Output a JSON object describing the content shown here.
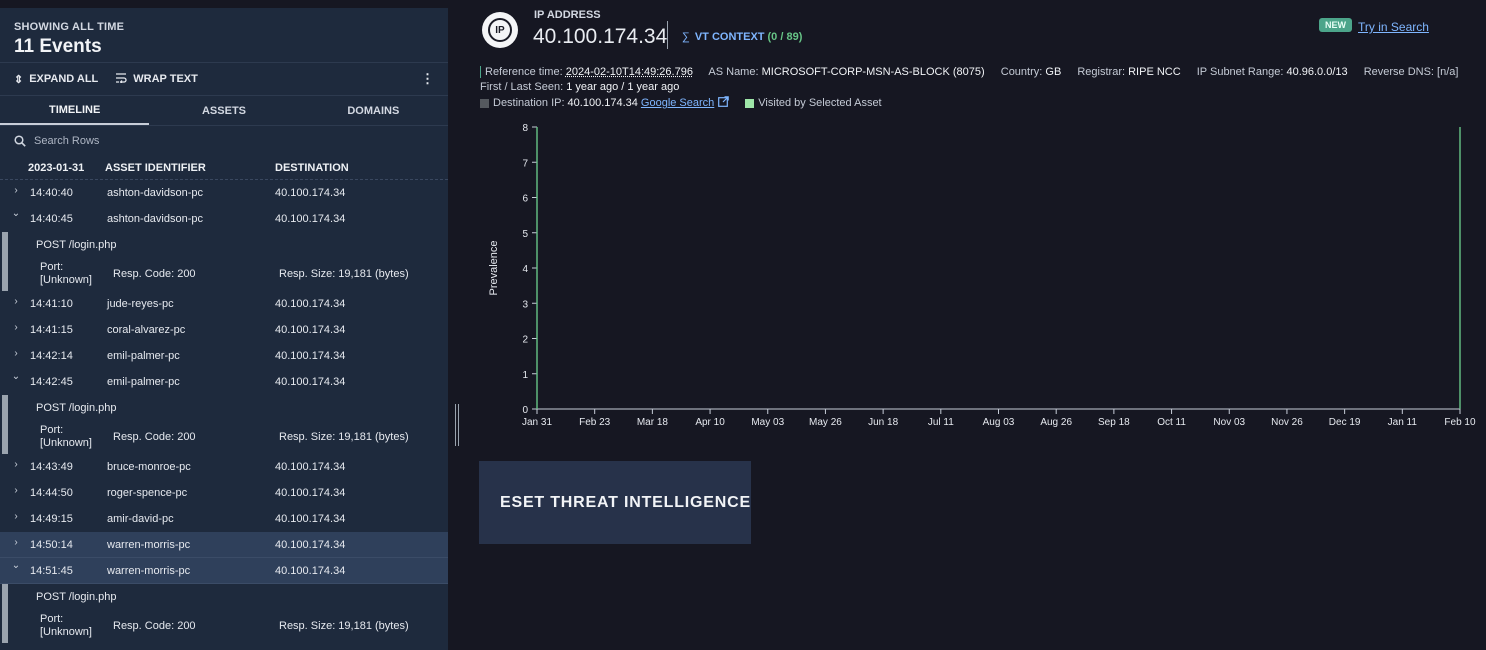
{
  "left": {
    "subtitle": "SHOWING ALL TIME",
    "title": "11 Events",
    "toolbar": {
      "expand_all": "EXPAND ALL",
      "wrap_text": "WRAP TEXT",
      "menu": "⋮"
    },
    "tabs": [
      {
        "label": "TIMELINE",
        "active": true
      },
      {
        "label": "ASSETS"
      },
      {
        "label": "DOMAINS"
      }
    ],
    "search_placeholder": "Search Rows",
    "columns": {
      "date": "2023-01-31",
      "asset": "ASSET IDENTIFIER",
      "destination": "DESTINATION"
    },
    "rows": [
      {
        "time": "14:40:40",
        "asset": "ashton-davidson-pc",
        "dest": "40.100.174.34",
        "expanded": false
      },
      {
        "time": "14:40:45",
        "asset": "ashton-davidson-pc",
        "dest": "40.100.174.34",
        "expanded": true,
        "detail": {
          "method": "POST /login.php",
          "port": "Port: [Unknown]",
          "code": "Resp. Code: 200",
          "size": "Resp. Size: 19,181 (bytes)"
        }
      },
      {
        "time": "14:41:10",
        "asset": "jude-reyes-pc",
        "dest": "40.100.174.34",
        "expanded": false
      },
      {
        "time": "14:41:15",
        "asset": "coral-alvarez-pc",
        "dest": "40.100.174.34",
        "expanded": false
      },
      {
        "time": "14:42:14",
        "asset": "emil-palmer-pc",
        "dest": "40.100.174.34",
        "expanded": false
      },
      {
        "time": "14:42:45",
        "asset": "emil-palmer-pc",
        "dest": "40.100.174.34",
        "expanded": true,
        "detail": {
          "method": "POST /login.php",
          "port": "Port: [Unknown]",
          "code": "Resp. Code: 200",
          "size": "Resp. Size: 19,181 (bytes)"
        }
      },
      {
        "time": "14:43:49",
        "asset": "bruce-monroe-pc",
        "dest": "40.100.174.34",
        "expanded": false
      },
      {
        "time": "14:44:50",
        "asset": "roger-spence-pc",
        "dest": "40.100.174.34",
        "expanded": false
      },
      {
        "time": "14:49:15",
        "asset": "amir-david-pc",
        "dest": "40.100.174.34",
        "expanded": false
      },
      {
        "time": "14:50:14",
        "asset": "warren-morris-pc",
        "dest": "40.100.174.34",
        "expanded": false,
        "selected": true
      },
      {
        "time": "14:51:45",
        "asset": "warren-morris-pc",
        "dest": "40.100.174.34",
        "expanded": true,
        "selected": true,
        "detail": {
          "method": "POST /login.php",
          "port": "Port: [Unknown]",
          "code": "Resp. Code: 200",
          "size": "Resp. Size: 19,181 (bytes)"
        }
      }
    ]
  },
  "header": {
    "logo_text": "IP",
    "label": "IP ADDRESS",
    "ip": "40.100.174.34",
    "vt_label": "VT CONTEXT",
    "vt_score": "(0 / 89)",
    "new_badge": "NEW",
    "try_link": "Try in Search"
  },
  "meta": {
    "ref_label": "Reference time:",
    "ref_value": "2024-02-10T14:49:26.796",
    "as_label": "AS Name:",
    "as_value": "MICROSOFT-CORP-MSN-AS-BLOCK (8075)",
    "country_label": "Country:",
    "country_value": "GB",
    "registrar_label": "Registrar:",
    "registrar_value": "RIPE NCC",
    "subnet_label": "IP Subnet Range:",
    "subnet_value": "40.96.0.0/13",
    "rdns_label": "Reverse DNS:",
    "rdns_value": "[n/a]",
    "seen_label": "First / Last Seen:",
    "seen_value": "1 year ago / 1 year ago",
    "dest_label": "Destination IP:",
    "dest_value": "40.100.174.34",
    "google": "Google Search",
    "visited": "Visited by Selected Asset"
  },
  "colors": {
    "accent_green": "#67c587",
    "link": "#7fb6ff",
    "legend_dest": "#55595f",
    "legend_visited": "#9ee6a8",
    "badge": "#4ca58a"
  },
  "chart_data": {
    "type": "line",
    "ylabel": "Prevalence",
    "xlabel": "",
    "ylim": [
      0,
      8
    ],
    "yticks": [
      0,
      1,
      2,
      3,
      4,
      5,
      6,
      7,
      8
    ],
    "xticks": [
      "Jan 31",
      "Feb 23",
      "Mar 18",
      "Apr 10",
      "May 03",
      "May 26",
      "Jun 18",
      "Jul 11",
      "Aug 03",
      "Aug 26",
      "Sep 18",
      "Oct 11",
      "Nov 03",
      "Nov 26",
      "Dec 19",
      "Jan 11",
      "Feb 10"
    ],
    "series": [
      {
        "x": [
          "Jan 31",
          "Feb 10"
        ],
        "values": [
          8,
          8
        ]
      }
    ]
  },
  "eset": {
    "label": "ESET THREAT INTELLIGENCE"
  }
}
